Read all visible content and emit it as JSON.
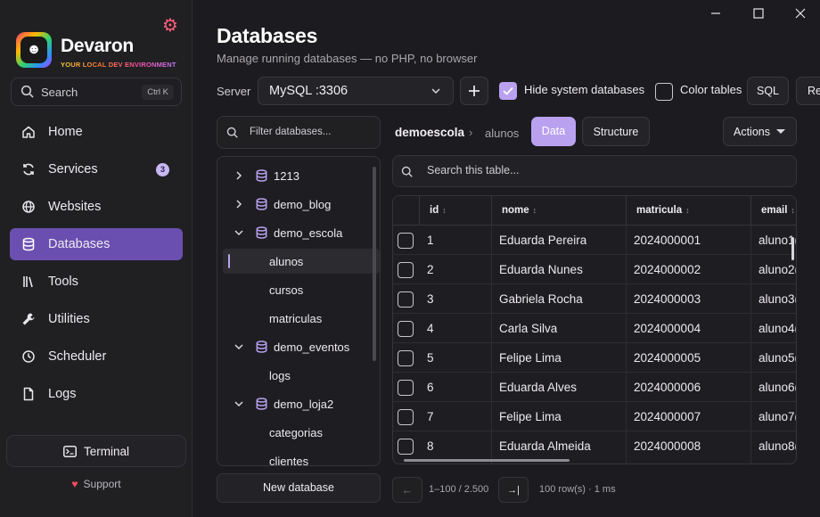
{
  "app": {
    "name": "Devaron",
    "tagline": "YOUR LOCAL DEV ENVIRONMENT"
  },
  "colors": {
    "accent": "#b9a1f0",
    "active_nav": "#6b4fb0",
    "bg": "#1c1b1f",
    "gear": "#ff5d7a",
    "heart": "#ff4a5e"
  },
  "sidebar": {
    "search_label": "Search",
    "search_shortcut": "Ctrl K",
    "items": [
      {
        "label": "Home",
        "icon": "home-icon"
      },
      {
        "label": "Services",
        "icon": "services-icon",
        "badge": "3"
      },
      {
        "label": "Websites",
        "icon": "globe-icon"
      },
      {
        "label": "Databases",
        "icon": "database-icon",
        "active": true
      },
      {
        "label": "Tools",
        "icon": "tools-icon"
      },
      {
        "label": "Utilities",
        "icon": "wrench-icon"
      },
      {
        "label": "Scheduler",
        "icon": "clock-icon"
      },
      {
        "label": "Logs",
        "icon": "file-icon"
      }
    ],
    "terminal_label": "Terminal",
    "support_label": "Support"
  },
  "header": {
    "title": "Databases",
    "subtitle": "Manage running databases — no PHP, no browser",
    "server_label": "Server",
    "server_value": "MySQL :3306",
    "hide_system_label": "Hide system databases",
    "hide_system_checked": true,
    "color_tables_label": "Color tables",
    "color_tables_checked": false,
    "sql_label": "SQL",
    "re_label": "Re"
  },
  "tree": {
    "filter_placeholder": "Filter databases...",
    "nodes": [
      {
        "label": "1213",
        "type": "db",
        "expanded": false
      },
      {
        "label": "demo_blog",
        "type": "db",
        "expanded": false
      },
      {
        "label": "demo_escola",
        "type": "db",
        "expanded": true
      },
      {
        "label": "alunos",
        "type": "table",
        "selected": true
      },
      {
        "label": "cursos",
        "type": "table"
      },
      {
        "label": "matriculas",
        "type": "table"
      },
      {
        "label": "demo_eventos",
        "type": "db",
        "expanded": true
      },
      {
        "label": "logs",
        "type": "table"
      },
      {
        "label": "demo_loja2",
        "type": "db",
        "expanded": true
      },
      {
        "label": "categorias",
        "type": "table"
      },
      {
        "label": "clientes",
        "type": "table"
      }
    ],
    "new_db_label": "New database"
  },
  "main": {
    "breadcrumb_db": "demoescola",
    "breadcrumb_sep": "›",
    "breadcrumb_table": "alunos",
    "tabs": [
      {
        "label": "Data",
        "active": true
      },
      {
        "label": "Structure",
        "active": false
      }
    ],
    "actions_label": "Actions",
    "search_placeholder": "Search this table...",
    "columns": [
      "id",
      "nome",
      "matricula",
      "email"
    ],
    "rows": [
      [
        "1",
        "Eduarda Pereira",
        "2024000001",
        "aluno1("
      ],
      [
        "2",
        "Eduarda Nunes",
        "2024000002",
        "aluno2("
      ],
      [
        "3",
        "Gabriela Rocha",
        "2024000003",
        "aluno3("
      ],
      [
        "4",
        "Carla Silva",
        "2024000004",
        "aluno4("
      ],
      [
        "5",
        "Felipe Lima",
        "2024000005",
        "aluno5("
      ],
      [
        "6",
        "Eduarda Alves",
        "2024000006",
        "aluno6("
      ],
      [
        "7",
        "Felipe Lima",
        "2024000007",
        "aluno7("
      ],
      [
        "8",
        "Eduarda Almeida",
        "2024000008",
        "aluno8("
      ]
    ],
    "pagination": {
      "prev": "←",
      "range": "1–100 / 2.500",
      "next": "→|",
      "info": "100 row(s) · 1 ms"
    }
  }
}
